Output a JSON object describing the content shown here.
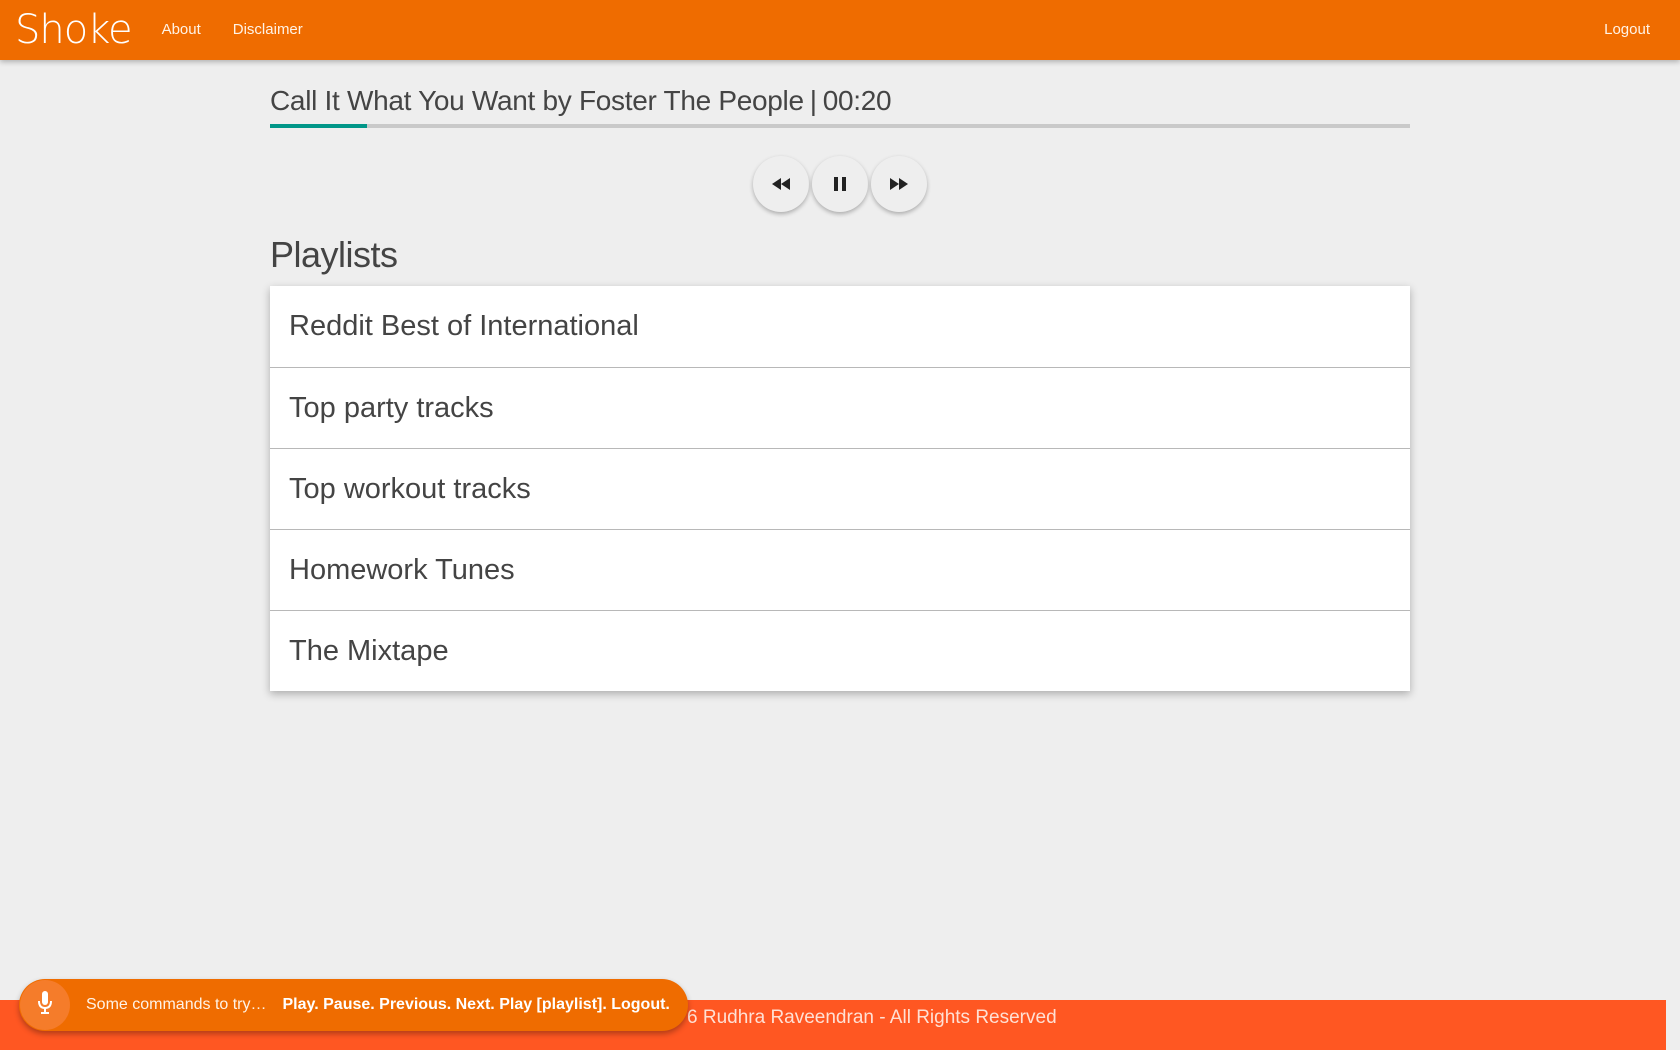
{
  "navbar": {
    "brand": "Shoke",
    "links": [
      "About",
      "Disclaimer"
    ],
    "logout": "Logout"
  },
  "player": {
    "track": "Call It What You Want",
    "by_word": "by",
    "artist": "Foster The People",
    "separator": "|",
    "time": "00:20",
    "progress": 0.085,
    "buttons": {
      "previous": "rewind-icon",
      "pause": "pause-icon",
      "next": "fast-forward-icon"
    }
  },
  "playlists": {
    "title": "Playlists",
    "items": [
      "Reddit Best of International",
      "Top party tracks",
      "Top workout tracks",
      "Homework Tunes",
      "The Mixtape"
    ]
  },
  "footer": {
    "text": "6 Rudhra Raveendran - All Rights Reserved"
  },
  "voice_toast": {
    "icon": "microphone-icon",
    "prefix": "Some commands to try…",
    "commands": "Play. Pause. Previous. Next. Play [playlist]. Logout."
  },
  "colors": {
    "navbar": "#ef6c00",
    "footer": "#ff5722",
    "progress": "#009688",
    "background": "#eeeeee"
  }
}
